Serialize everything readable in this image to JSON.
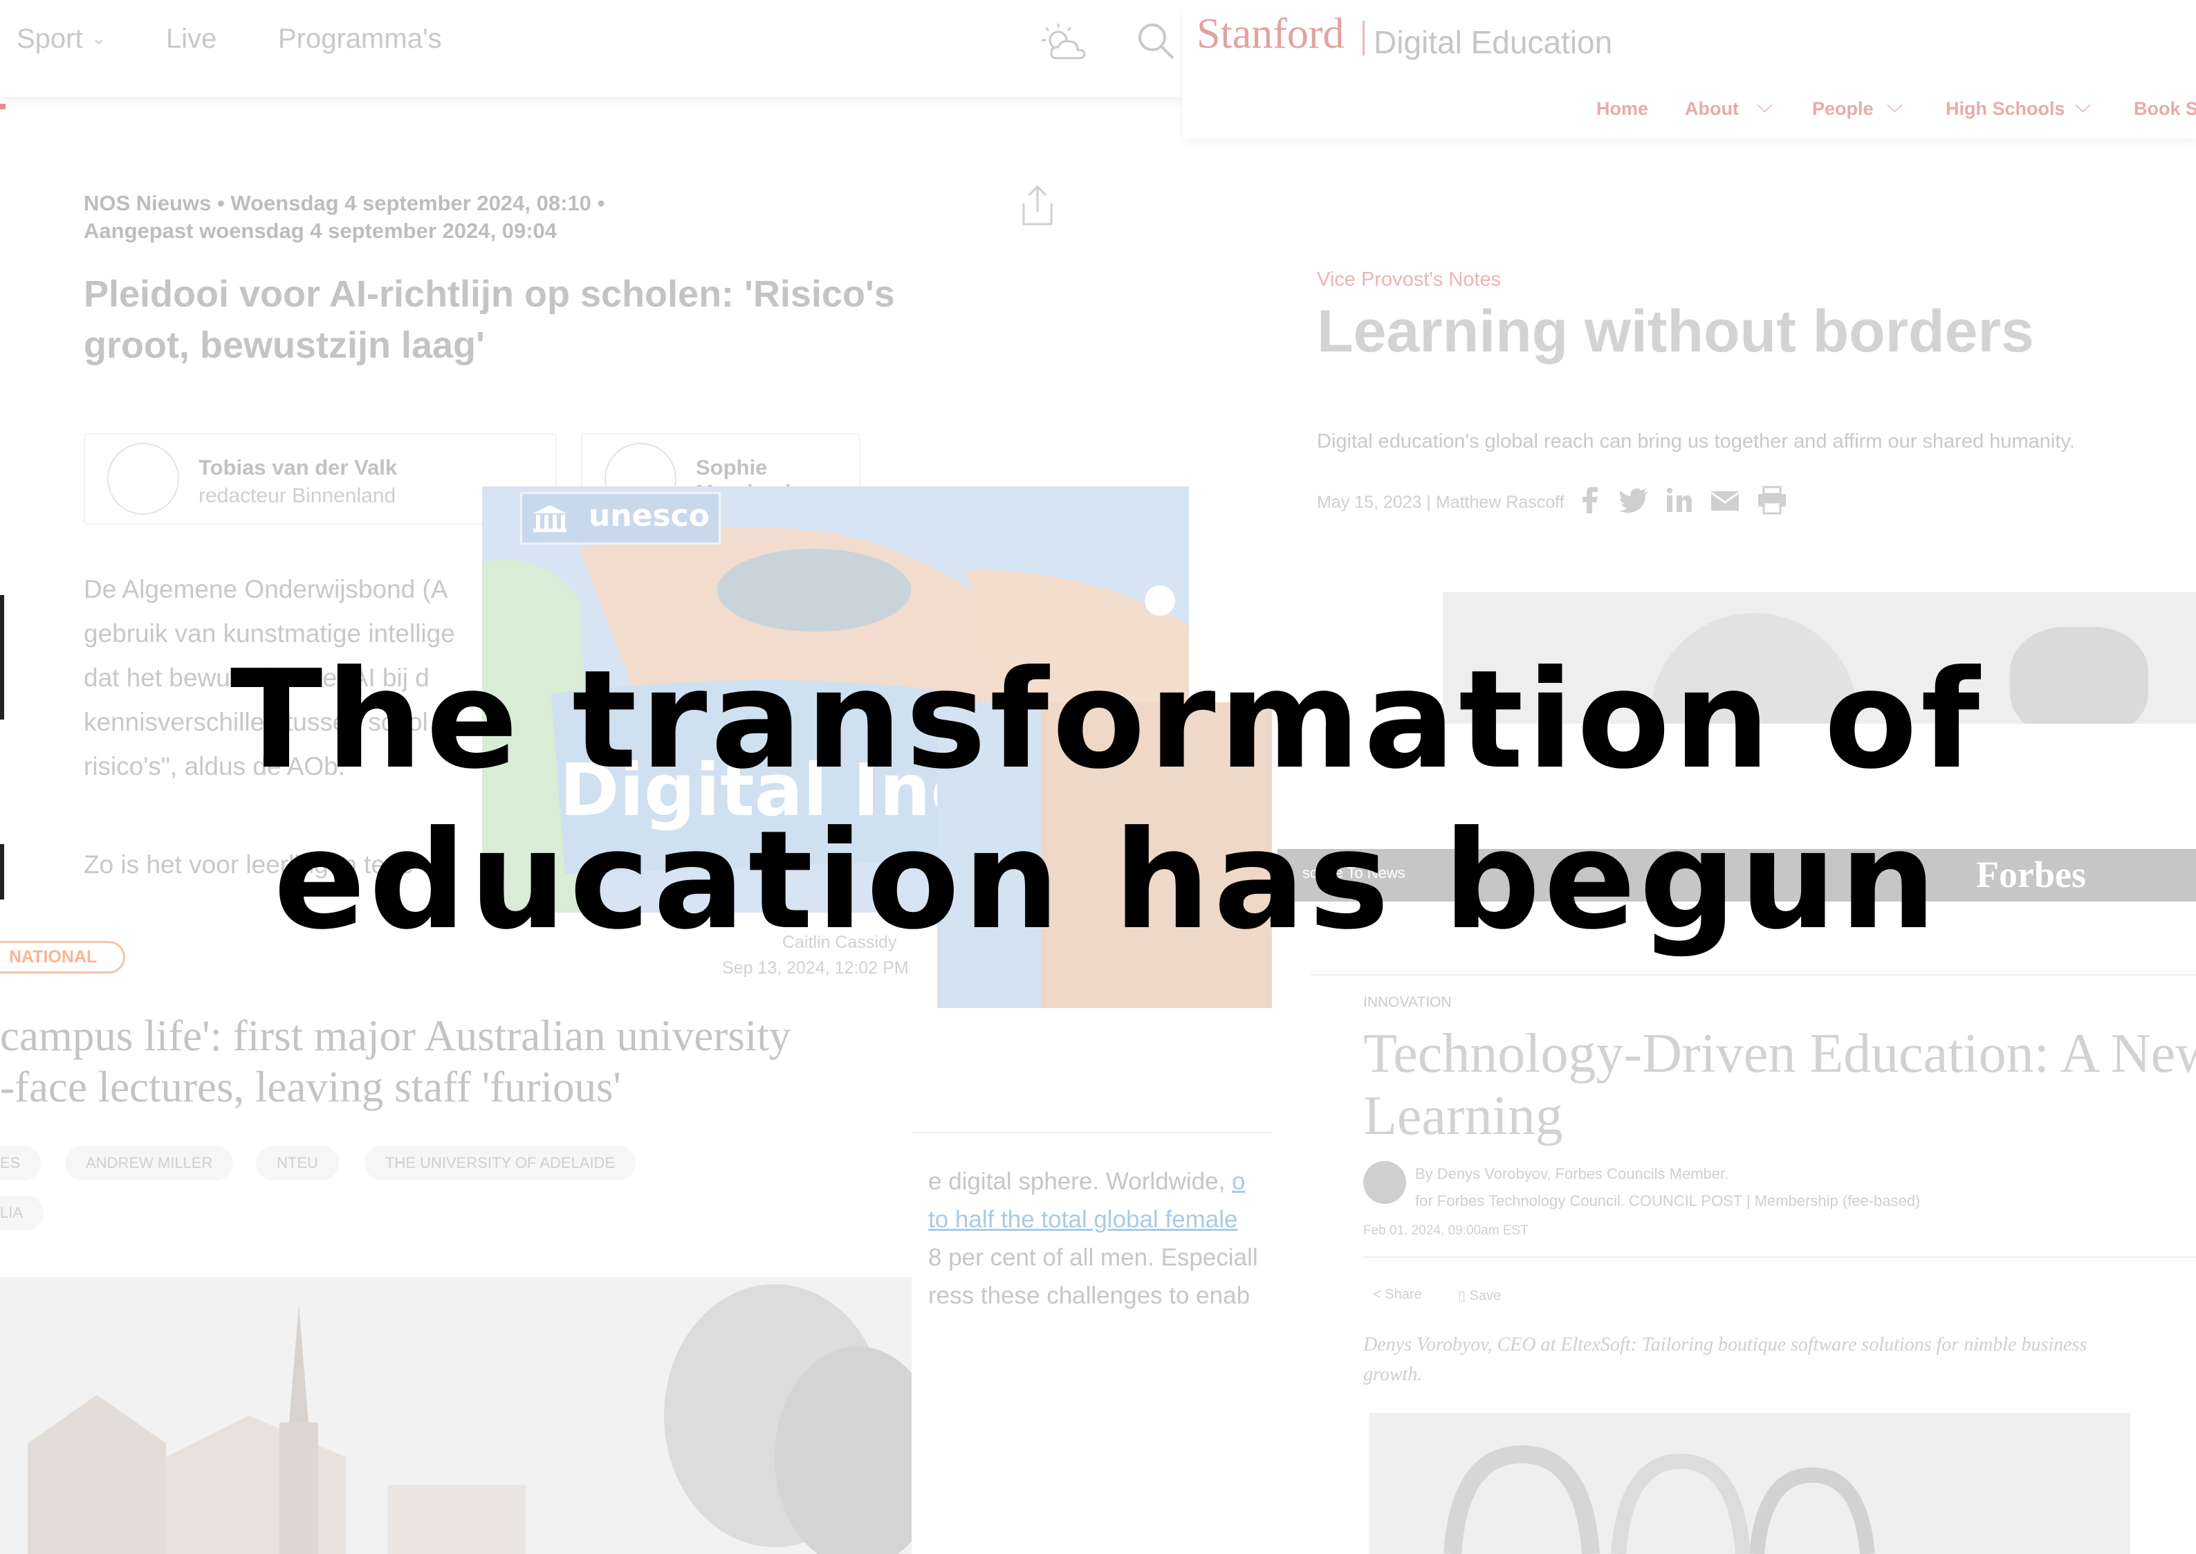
{
  "nos": {
    "nav": [
      "Sport",
      "Live",
      "Programma's"
    ],
    "meta_line1": "NOS Nieuws  •  Woensdag 4 september 2024, 08:10  •",
    "meta_line2": "Aangepast woensdag 4 september 2024, 09:04",
    "title": "Pleidooi voor AI-richtlijn op scholen: 'Risico's groot, bewustzijn laag'",
    "authors": [
      {
        "name": "Tobias van der Valk",
        "role": "redacteur Binnenland"
      },
      {
        "name": "Sophie Moerland",
        "role": ""
      }
    ],
    "paragraph1": [
      "De Algemene Onderwijsbond (A",
      "gebruik van kunstmatige intellige",
      "dat het bewustzijn over AI bij d",
      "kennisverschillen tussen schol",
      "risico's\", aldus de AOb."
    ],
    "paragraph2": "Zo is het voor leerlingen tege"
  },
  "unesco": {
    "logo_text": "unesco",
    "banner_text": "Digital Inclusion"
  },
  "stanford": {
    "brand": "Stanford",
    "brand_sub": "Digital Education",
    "nav": [
      "Home",
      "About",
      "People",
      "High Schools",
      "Book Se"
    ],
    "category": "Vice Provost's Notes",
    "title": "Learning without borders",
    "description": "Digital education's global reach can bring us together and affirm our shared humanity.",
    "byline": "May 15, 2023 | Matthew Rascoff"
  },
  "forbes": {
    "logo": "Forbes",
    "subscribe_fragment": "scribe To News",
    "category": "INNOVATION",
    "title": "Technology-Driven Education: A New E Learning",
    "byline_by": "By Denys Vorobyov, Forbes Councils Member.",
    "byline_for": "for Forbes Technology Council. COUNCIL POST | Membership (fee-based)",
    "date": "Feb 01, 2024, 09:00am EST",
    "share_label": "Share",
    "save_label": "Save",
    "caption": "Denys Vorobyov, CEO at EltexSoft: Tailoring boutique software solutions for nimble business growth."
  },
  "guardian": {
    "badge": "NATIONAL",
    "author": "Caitlin Cassidy",
    "date": "Sep 13, 2024, 12:02 PM",
    "title_line1": "campus life': first major Australian university",
    "title_line2": "-face lectures, leaving staff 'furious'",
    "tags": [
      "ES",
      "ANDREW MILLER",
      "NTEU",
      "THE UNIVERSITY OF ADELAIDE"
    ],
    "tag_row2": [
      "LIA"
    ]
  },
  "unesco_article": {
    "line1_text": "e digital sphere. Worldwide, ",
    "line1_link": "o",
    "line2_link": " to half the total global female",
    "line3": "8 per cent of all men. Especiall",
    "line4": "ress these challenges to enab"
  },
  "headline": {
    "line1": "The transformation of",
    "line2": "education has begun"
  }
}
